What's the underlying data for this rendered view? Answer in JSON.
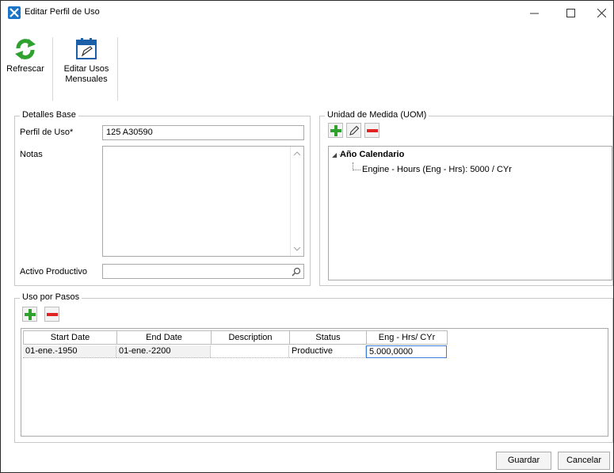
{
  "window": {
    "title": "Editar Perfil de Uso"
  },
  "toolbar": {
    "refresh_label": "Refrescar",
    "edit_label": "Editar Usos Mensuales"
  },
  "details": {
    "group_title": "Detalles Base",
    "profile_label": "Perfil de Uso*",
    "profile_value": "125 A30590",
    "notes_label": "Notas",
    "notes_value": "",
    "asset_label": "Activo Productivo",
    "asset_value": ""
  },
  "uom": {
    "group_title": "Unidad de Medida (UOM)",
    "tree_root": "Año Calendario",
    "tree_child": "Engine - Hours (Eng - Hrs): 5000 / CYr"
  },
  "steps": {
    "group_title": "Uso por Pasos",
    "columns": [
      "Start Date",
      "End Date",
      "Description",
      "Status",
      "Eng - Hrs/ CYr"
    ],
    "rows": [
      {
        "start": "01-ene.-1950",
        "end": "01-ene.-2200",
        "description": "",
        "status": "Productive",
        "value": "5.000,0000"
      }
    ]
  },
  "footer": {
    "save_label": "Guardar",
    "cancel_label": "Cancelar"
  },
  "colors": {
    "accent_green": "#2ea12e",
    "accent_red": "#e02424",
    "accent_blue": "#1b75c9"
  },
  "icons": [
    "app-tools-icon",
    "refresh-icon",
    "calendar-edit-icon",
    "add-icon",
    "pencil-icon",
    "remove-icon",
    "search-icon"
  ]
}
